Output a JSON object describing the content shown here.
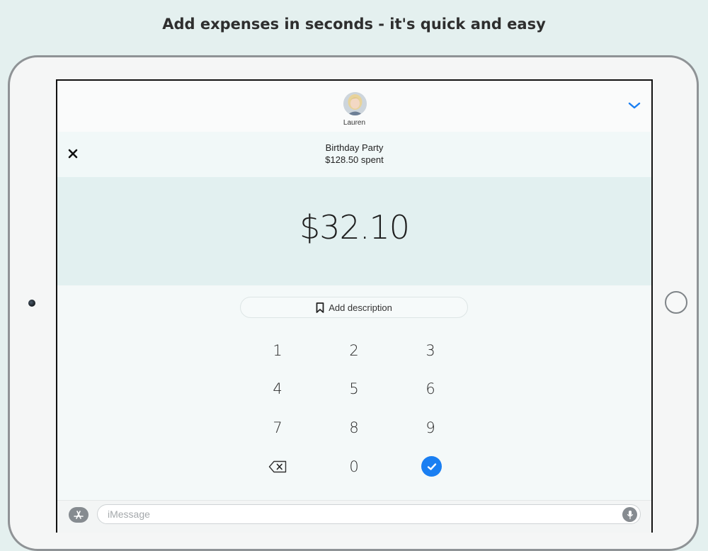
{
  "headline": "Add expenses in seconds - it's quick and easy",
  "contact": {
    "name": "Lauren"
  },
  "group": {
    "title": "Birthday Party",
    "spent": "$128.50 spent"
  },
  "amount": "$32.10",
  "description_button": {
    "label": "Add description",
    "icon": "bookmark-icon"
  },
  "keypad": {
    "keys": [
      "1",
      "2",
      "3",
      "4",
      "5",
      "6",
      "7",
      "8",
      "9",
      "0"
    ],
    "delete_icon": "backspace-icon",
    "confirm_icon": "checkmark-icon"
  },
  "compose": {
    "placeholder": "iMessage",
    "left_icon": "app-store-icon",
    "right_icon": "microphone-icon"
  },
  "colors": {
    "background": "#e4f0ef",
    "amount_panel": "#e2f0f0",
    "accent_blue": "#1a7ff2",
    "device_frame": "#f5f6f6"
  }
}
